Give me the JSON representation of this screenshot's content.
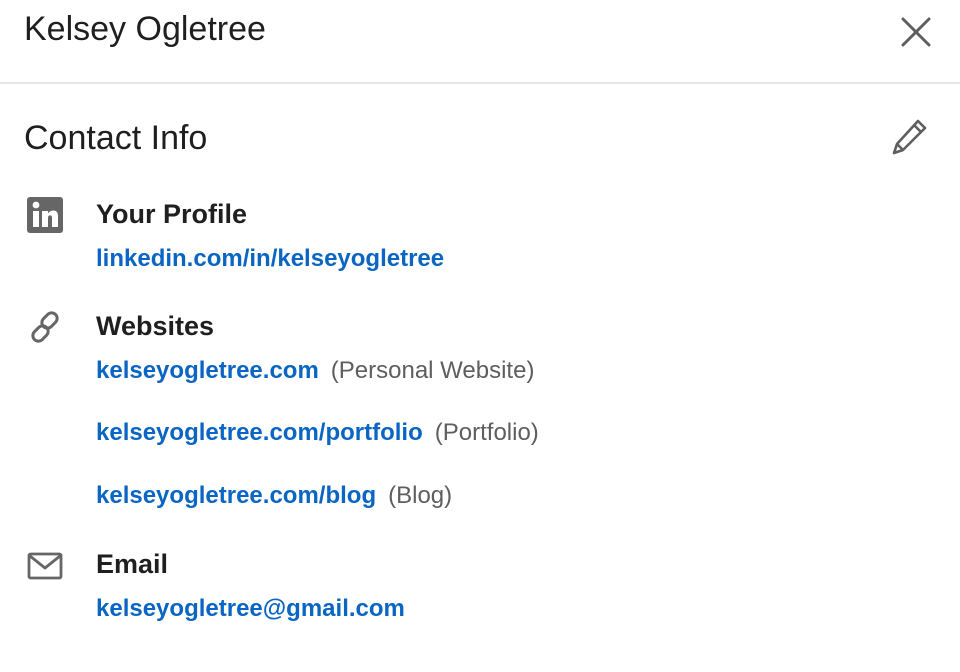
{
  "header": {
    "title": "Kelsey Ogletree",
    "close_icon": "close-icon"
  },
  "contact": {
    "title": "Contact Info",
    "edit_icon": "pencil-icon",
    "profile": {
      "icon": "linkedin-icon",
      "heading": "Your Profile",
      "url": "linkedin.com/in/kelseyogletree"
    },
    "websites": {
      "icon": "link-icon",
      "heading": "Websites",
      "items": [
        {
          "url": "kelseyogletree.com",
          "type": "(Personal Website)"
        },
        {
          "url": "kelseyogletree.com/portfolio",
          "type": "(Portfolio)"
        },
        {
          "url": "kelseyogletree.com/blog",
          "type": "(Blog)"
        }
      ]
    },
    "email": {
      "icon": "envelope-icon",
      "heading": "Email",
      "address": "kelseyogletree@gmail.com"
    }
  },
  "colors": {
    "link": "#0a66c2",
    "text": "#1f1f1f",
    "muted": "#5e5e5e",
    "icon": "#666666",
    "divider": "#e5e5e5"
  }
}
